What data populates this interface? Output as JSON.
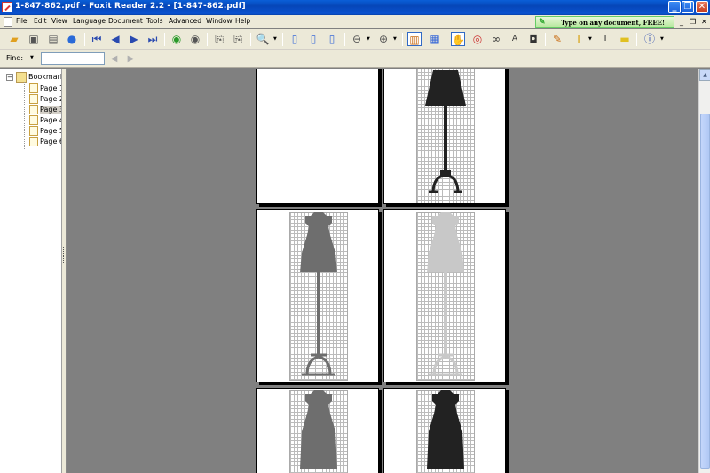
{
  "window": {
    "title": "1-847-862.pdf - Foxit Reader 2.2 - [1-847-862.pdf]",
    "buttons": {
      "minimize": "_",
      "maximize": "❐",
      "close": "✕"
    }
  },
  "menu": {
    "items": [
      "File",
      "Edit",
      "View",
      "Language",
      "Document",
      "Tools",
      "Advanced",
      "Window",
      "Help"
    ],
    "ad_text": "Type on any document, FREE!",
    "mdi_minimize": "_",
    "mdi_restore": "❐",
    "mdi_close": "✕"
  },
  "toolbar": {
    "icons": [
      "open-folder-icon",
      "save-icon",
      "print-icon",
      "email-icon",
      "first-page-icon",
      "previous-page-icon",
      "next-page-icon",
      "last-page-icon",
      "go-back-icon",
      "go-forward-icon",
      "rotate-left-icon",
      "rotate-right-icon",
      "zoom-in-tool-icon",
      "actual-size-icon",
      "fit-page-icon",
      "fit-width-icon",
      "zoom-out-icon",
      "zoom-in-icon",
      "bookmark-panel-icon",
      "thumbnail-panel-icon",
      "hand-tool-icon",
      "text-select-icon",
      "find-binoculars-icon",
      "text-viewer-icon",
      "snapshot-icon",
      "typewriter-icon",
      "highlight-icon",
      "text-tool-icon",
      "note-icon",
      "info-icon"
    ]
  },
  "findbar": {
    "label": "Find:",
    "value": ""
  },
  "bookmarks": {
    "root": "Bookmark",
    "items": [
      {
        "label": "Page 1"
      },
      {
        "label": "Page 2"
      },
      {
        "label": "Page 3"
      },
      {
        "label": "Page 4"
      },
      {
        "label": "Page 5"
      },
      {
        "label": "Page 6"
      }
    ],
    "selected_index": 2
  },
  "document": {
    "pages": [
      {
        "name": "page-blank",
        "content": "blank"
      },
      {
        "name": "page-form-dark-1",
        "content": "dress-form-dark"
      },
      {
        "name": "page-form-gray",
        "content": "dress-form-gray"
      },
      {
        "name": "page-form-light",
        "content": "dress-form-light"
      },
      {
        "name": "page-form-gray-2",
        "content": "dress-form-gray"
      },
      {
        "name": "page-form-dark-2",
        "content": "dress-form-dark"
      }
    ],
    "colors": {
      "dark": "#222222",
      "gray": "#6e6e6e",
      "light": "#c8c8c8",
      "background": "#808080"
    }
  }
}
